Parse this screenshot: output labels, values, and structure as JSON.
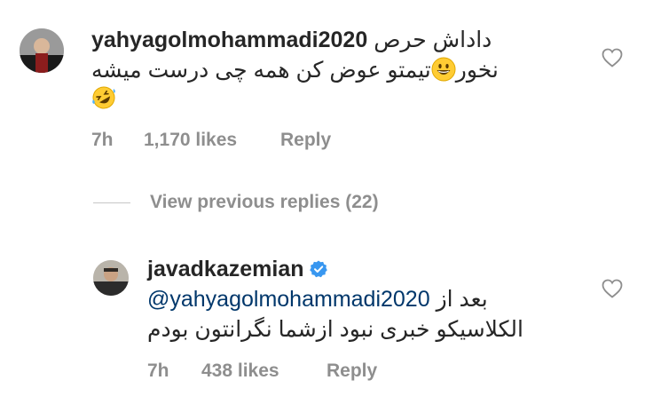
{
  "comment": {
    "username": "yahyagolmohammadi2020",
    "text_line1": "داداش حرص",
    "text_line2_start": "نخور",
    "text_line2_end": "تیمتو عوض کن همه چی درست میشه",
    "time": "7h",
    "likes": "1,170 likes",
    "reply_label": "Reply",
    "emojis": [
      "grinning-face",
      "rolling-on-floor-laughing"
    ]
  },
  "view_previous": {
    "label": "View previous replies (22)"
  },
  "reply": {
    "username": "javadkazemian",
    "verified": true,
    "text_line1_start": "بعد از",
    "mention": "@yahyagolmohammadi2020",
    "text_line2": "الکلاسیکو خبری نبود ازشما نگرانتون بودم",
    "time": "7h",
    "likes": "438 likes",
    "reply_label": "Reply"
  },
  "colors": {
    "text": "#262626",
    "meta": "#8e8e8e",
    "mention": "#00376b",
    "verified": "#3897f0"
  }
}
